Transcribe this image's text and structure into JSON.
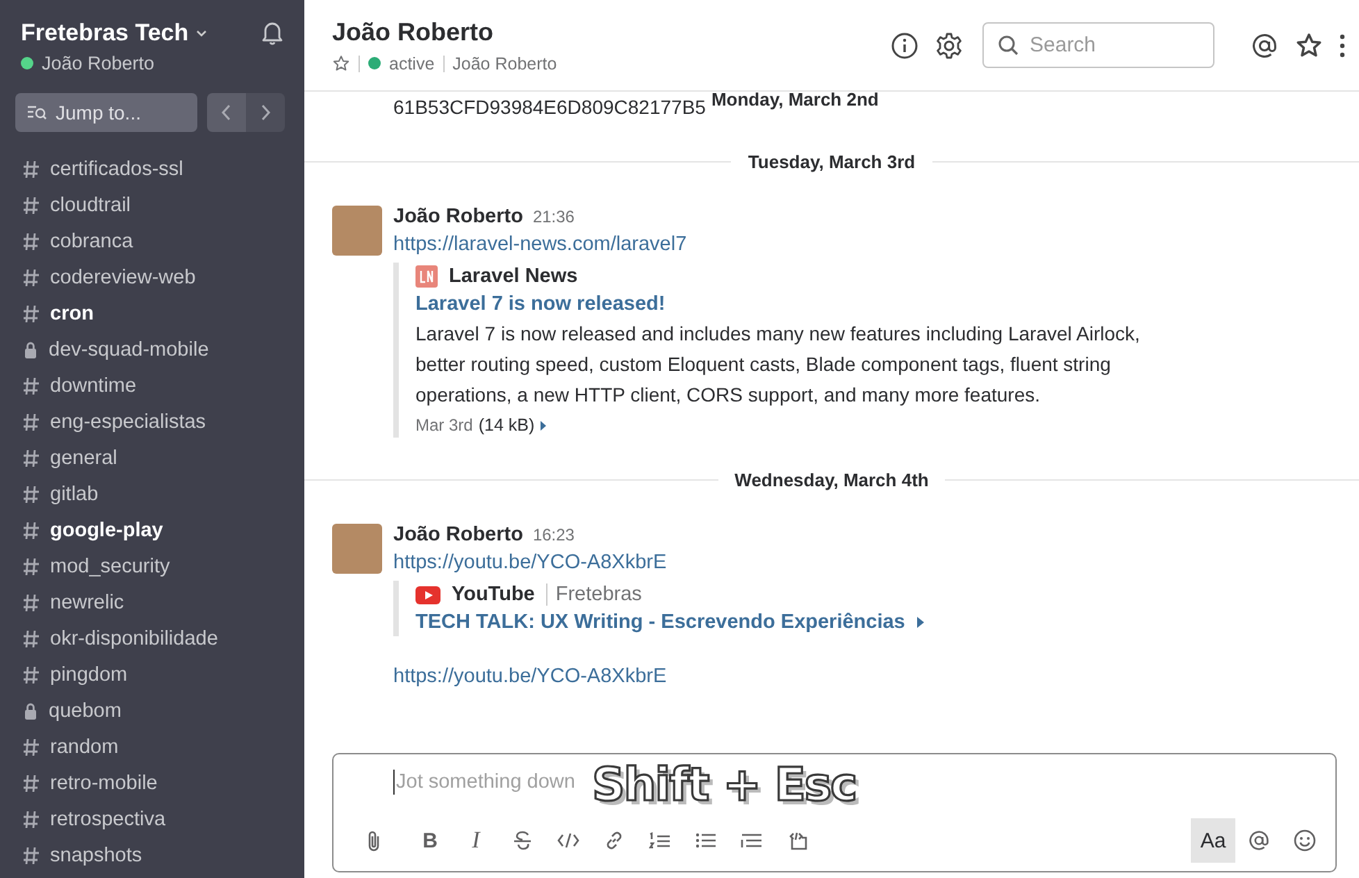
{
  "workspace": {
    "name": "Fretebras Tech",
    "user": "João Roberto",
    "user_online": true
  },
  "jump_to": {
    "placeholder": "Jump to..."
  },
  "history_nav": {
    "back_enabled": true,
    "forward_enabled": false
  },
  "channels": [
    {
      "name": "certificados-ssl",
      "kind": "public",
      "unread": false
    },
    {
      "name": "cloudtrail",
      "kind": "public",
      "unread": false
    },
    {
      "name": "cobranca",
      "kind": "public",
      "unread": false
    },
    {
      "name": "codereview-web",
      "kind": "public",
      "unread": false
    },
    {
      "name": "cron",
      "kind": "public",
      "unread": true
    },
    {
      "name": "dev-squad-mobile",
      "kind": "private",
      "unread": false
    },
    {
      "name": "downtime",
      "kind": "public",
      "unread": false
    },
    {
      "name": "eng-especialistas",
      "kind": "public",
      "unread": false
    },
    {
      "name": "general",
      "kind": "public",
      "unread": false
    },
    {
      "name": "gitlab",
      "kind": "public",
      "unread": false
    },
    {
      "name": "google-play",
      "kind": "public",
      "unread": true
    },
    {
      "name": "mod_security",
      "kind": "public",
      "unread": false
    },
    {
      "name": "newrelic",
      "kind": "public",
      "unread": false
    },
    {
      "name": "okr-disponibilidade",
      "kind": "public",
      "unread": false
    },
    {
      "name": "pingdom",
      "kind": "public",
      "unread": false
    },
    {
      "name": "quebom",
      "kind": "private",
      "unread": false
    },
    {
      "name": "random",
      "kind": "public",
      "unread": false
    },
    {
      "name": "retro-mobile",
      "kind": "public",
      "unread": false
    },
    {
      "name": "retrospectiva",
      "kind": "public",
      "unread": false
    },
    {
      "name": "snapshots",
      "kind": "public",
      "unread": false
    }
  ],
  "channel_header": {
    "title": "João Roberto",
    "starred": false,
    "status": "active",
    "status_online": true,
    "full_name": "João Roberto"
  },
  "search": {
    "placeholder": "Search"
  },
  "timeline": [
    {
      "kind": "fragment",
      "text": "61B53CFD93984E6D809C82177B5",
      "sticky_date": "Monday, March 2nd"
    },
    {
      "kind": "divider",
      "label": "Tuesday, March 3rd"
    },
    {
      "kind": "message",
      "author": "João Roberto",
      "time": "21:36",
      "text": "https://laravel-news.com/laravel7",
      "attachment": {
        "kind": "article",
        "service": "Laravel News",
        "title": "Laravel 7 is now released!",
        "body": "Laravel 7 is now released and includes many new features including Laravel Airlock, better routing speed, custom Eloquent casts, Blade component tags, fluent string operations, a new HTTP client, CORS support, and many more features.",
        "footer_date": "Mar 3rd",
        "footer_size": "(14 kB)"
      }
    },
    {
      "kind": "divider",
      "label": "Wednesday, March 4th"
    },
    {
      "kind": "message",
      "author": "João Roberto",
      "time": "16:23",
      "text": "https://youtu.be/YCO-A8XkbrE",
      "attachment": {
        "kind": "video",
        "service": "YouTube",
        "source": "Fretebras",
        "title": "TECH TALK: UX Writing - Escrevendo Experiências"
      }
    },
    {
      "kind": "continuation",
      "text": "https://youtu.be/YCO-A8XkbrE"
    }
  ],
  "composer": {
    "placeholder": "Jot something down",
    "keystroke_overlay": "Shift + Esc",
    "tools": [
      {
        "kind": "attach"
      },
      {
        "kind": "bold",
        "glyph": "B"
      },
      {
        "kind": "italic",
        "glyph": "I"
      },
      {
        "kind": "strike"
      },
      {
        "kind": "code"
      },
      {
        "kind": "link"
      },
      {
        "kind": "ordered"
      },
      {
        "kind": "bullets"
      },
      {
        "kind": "quote"
      },
      {
        "kind": "codeblock"
      }
    ],
    "format_toggle": {
      "label": "Aa",
      "selected": true
    }
  }
}
